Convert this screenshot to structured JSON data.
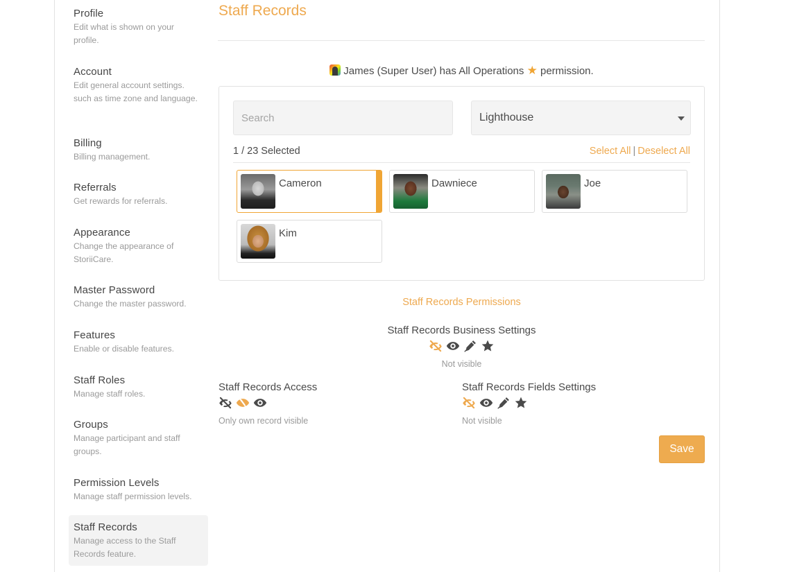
{
  "sidebar": {
    "items": [
      {
        "title": "Profile",
        "desc": "Edit what is shown on your profile."
      },
      {
        "title": "Account",
        "desc": "Edit general account settings. such as time zone and language."
      },
      {
        "title": "Billing",
        "desc": "Billing management."
      },
      {
        "title": "Referrals",
        "desc": "Get rewards for referrals."
      },
      {
        "title": "Appearance",
        "desc": "Change the appearance of StoriiCare."
      },
      {
        "title": "Master Password",
        "desc": "Change the master password."
      },
      {
        "title": "Features",
        "desc": "Enable or disable features."
      },
      {
        "title": "Staff Roles",
        "desc": "Manage staff roles."
      },
      {
        "title": "Groups",
        "desc": "Manage participant and staff groups."
      },
      {
        "title": "Permission Levels",
        "desc": "Manage staff permission levels."
      },
      {
        "title": "Staff Records",
        "desc": "Manage access to the Staff Records feature.",
        "active": true
      }
    ]
  },
  "main": {
    "title": "Staff Records",
    "super_user_note": {
      "prefix": "James (Super User) has All Operations",
      "suffix": "permission."
    },
    "picker": {
      "search_placeholder": "Search",
      "search_value": "",
      "location_select": "Lighthouse",
      "selected_count": "1 / 23 Selected",
      "select_all": "Select All",
      "separator": "|",
      "deselect_all": "Deselect All",
      "staff": [
        {
          "name": "Cameron",
          "selected": true
        },
        {
          "name": "Dawniece",
          "selected": false
        },
        {
          "name": "Joe",
          "selected": false
        },
        {
          "name": "Kim",
          "selected": false
        }
      ]
    },
    "permissions": {
      "heading": "Staff Records Permissions",
      "business_settings": {
        "title": "Staff Records Business Settings",
        "icons": [
          "eye-slash-icon (active)",
          "eye-icon",
          "pen-icon",
          "star-icon"
        ],
        "status": "Not visible"
      },
      "access": {
        "title": "Staff Records Access",
        "icons": [
          "eye-slash-icon",
          "own-record-icon (active)",
          "eye-icon"
        ],
        "status": "Only own record visible"
      },
      "fields_settings": {
        "title": "Staff Records Fields Settings",
        "icons": [
          "eye-slash-icon (active)",
          "eye-icon",
          "pen-icon",
          "star-icon"
        ],
        "status": "Not visible"
      }
    },
    "save_label": "Save"
  },
  "colors": {
    "accent": "#eea94f",
    "icon_default": "#4a4a4a",
    "selected_border": "#f0a534"
  }
}
